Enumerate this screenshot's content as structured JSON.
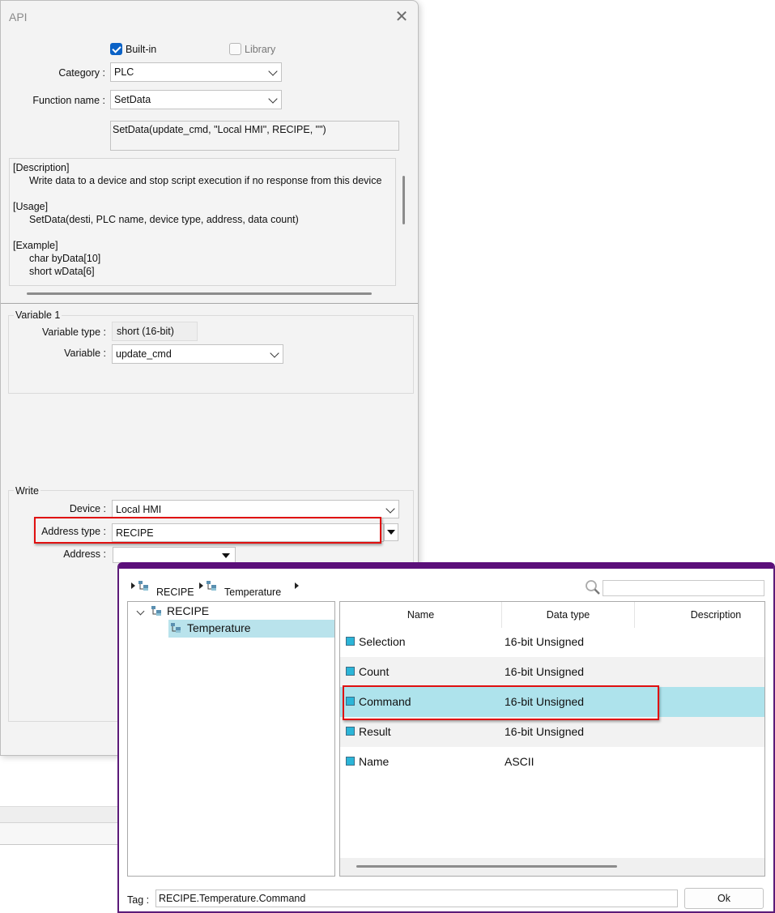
{
  "background": {
    "strip": ""
  },
  "api_dialog": {
    "title": "API",
    "builtin_label": "Built-in",
    "library_label": "Library",
    "category_label": "Category :",
    "category_value": "PLC",
    "function_label": "Function name :",
    "function_value": "SetData",
    "prototype": "SetData(update_cmd, \"Local HMI\", RECIPE, \"\")",
    "description_lines": [
      "[Description]",
      "Write data to a device and stop script execution if no response from this device",
      "[Usage]",
      "SetData(desti, PLC name, device type, address, data count)",
      "[Example]",
      "char byData[10]",
      "short wData[6]"
    ],
    "variable1": {
      "title": "Variable 1",
      "type_label": "Variable type :",
      "type_value": "short (16-bit)",
      "var_label": "Variable :",
      "var_value": "update_cmd"
    },
    "write": {
      "title": "Write",
      "device_label": "Device :",
      "device_value": "Local HMI",
      "address_type_label": "Address type :",
      "address_type_value": "RECIPE",
      "address_label": "Address :",
      "address_value": ""
    }
  },
  "tag_picker": {
    "breadcrumb": [
      "RECIPE",
      "Temperature"
    ],
    "search_placeholder": "",
    "tree": {
      "root": "RECIPE",
      "child": "Temperature"
    },
    "columns": [
      "Name",
      "Data type",
      "Description"
    ],
    "rows": [
      {
        "name": "Selection",
        "type": "16-bit Unsigned",
        "description": ""
      },
      {
        "name": "Count",
        "type": "16-bit Unsigned",
        "description": ""
      },
      {
        "name": "Command",
        "type": "16-bit Unsigned",
        "description": ""
      },
      {
        "name": "Result",
        "type": "16-bit Unsigned",
        "description": ""
      },
      {
        "name": "Name",
        "type": "ASCII",
        "description": ""
      }
    ],
    "selected_row": "Command",
    "tag_label": "Tag :",
    "tag_value": "RECIPE.Temperature.Command",
    "ok_label": "Ok"
  },
  "colors": {
    "accent": "#0b62c6",
    "highlight_box": "#e01010",
    "selection": "#aee3ec",
    "picker_border": "#5b0f7a"
  }
}
